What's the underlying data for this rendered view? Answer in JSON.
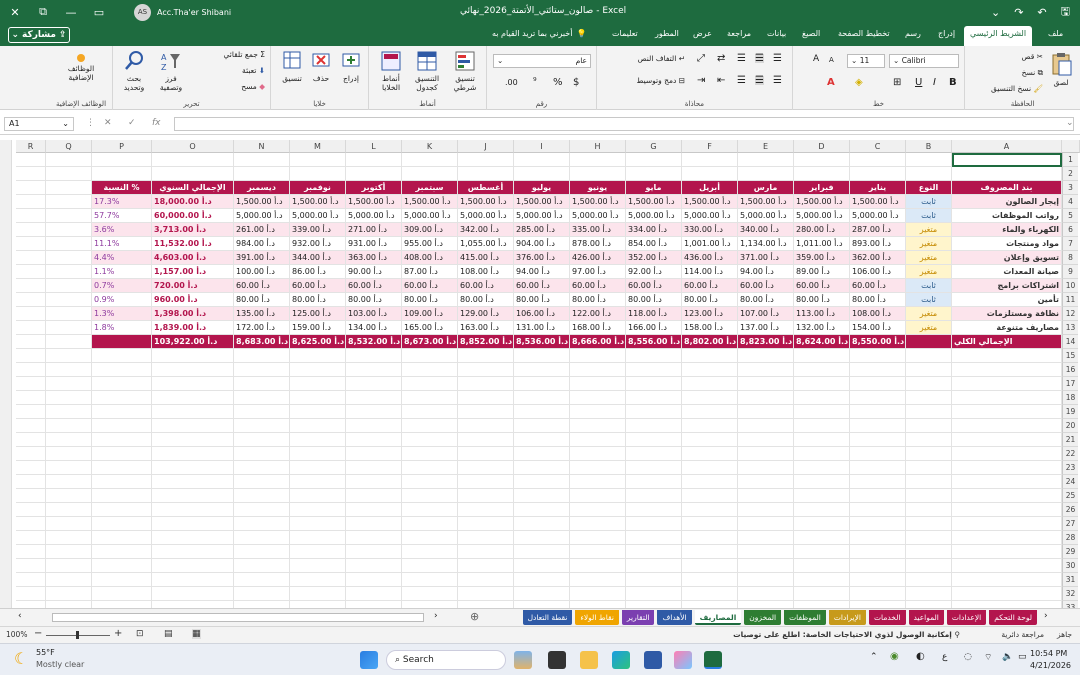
{
  "titlebar": {
    "app": "Excel",
    "filename": "صالون_ستائتي_الأتمتة_2026_نهائي",
    "separator": "-",
    "user_initials": "AS",
    "user_name": "Acc.Tha'er Shibani"
  },
  "tabs": [
    "ملف",
    "الشريط الرئيسي",
    "إدراج",
    "رسم",
    "تخطيط الصفحة",
    "الصيغ",
    "بيانات",
    "مراجعة",
    "عرض",
    "المطور",
    "تعليمات"
  ],
  "tell_me": "أخبرني بما تريد القيام به",
  "share": "مشاركة",
  "ribbon": {
    "clipboard": {
      "label": "الحافظة",
      "paste": "لصق",
      "cut": "قص",
      "copy": "نسخ",
      "format_painter": "نسخ التنسيق"
    },
    "font": {
      "label": "خط",
      "name": "Calibri",
      "size": "11",
      "bold": "B",
      "italic": "I",
      "underline": "U"
    },
    "alignment": {
      "label": "محاذاة",
      "wrap": "التفاف النص",
      "merge": "دمج وتوسيط"
    },
    "number": {
      "label": "رقم",
      "format": "عام",
      "currency": "$",
      "percent": "%"
    },
    "styles": {
      "label": "أنماط",
      "conditional": "تنسيق شرطي",
      "table": "التنسيق كجدول",
      "cell_styles": "أنماط الخلايا"
    },
    "cells": {
      "label": "خلايا",
      "insert": "إدراج",
      "delete": "حذف",
      "format": "تنسيق"
    },
    "editing": {
      "label": "تحرير",
      "autosum": "جمع تلقائي",
      "fill": "تعبئة",
      "clear": "مسح",
      "sort": "فرز وتصفية",
      "find": "بحث وتحديد"
    },
    "addins": {
      "label": "الوظائف الإضافية",
      "btn": "الوظائف الإضافية"
    }
  },
  "formula": {
    "namebox": "A1",
    "fx": "fx",
    "value": ""
  },
  "columns": [
    "A",
    "B",
    "C",
    "D",
    "E",
    "F",
    "G",
    "H",
    "I",
    "J",
    "K",
    "L",
    "M",
    "N",
    "O",
    "P",
    "Q",
    "R"
  ],
  "rows": [
    "1",
    "2",
    "3",
    "4",
    "5",
    "6",
    "7",
    "8",
    "9",
    "10",
    "11",
    "12",
    "13",
    "14",
    "15",
    "16",
    "17",
    "18",
    "19",
    "20",
    "21",
    "22",
    "23",
    "24",
    "25",
    "26",
    "27",
    "28",
    "29",
    "30",
    "31",
    "32",
    "33"
  ],
  "table": {
    "headers": [
      "بند المصروف",
      "النوع",
      "يناير",
      "فبراير",
      "مارس",
      "أبريل",
      "مايو",
      "يونيو",
      "يوليو",
      "أغسطس",
      "سبتمبر",
      "أكتوبر",
      "نوفمبر",
      "ديسمبر",
      "الإجمالي السنوي",
      "النسبة %"
    ],
    "rows": [
      [
        "إيجار الصالون",
        "ثابت",
        "1,500.00 د.أ",
        "1,500.00 د.أ",
        "1,500.00 د.أ",
        "1,500.00 د.أ",
        "1,500.00 د.أ",
        "1,500.00 د.أ",
        "1,500.00 د.أ",
        "1,500.00 د.أ",
        "1,500.00 د.أ",
        "1,500.00 د.أ",
        "1,500.00 د.أ",
        "1,500.00 د.أ",
        "18,000.00 د.أ",
        "17.3%"
      ],
      [
        "رواتب الموظفات",
        "ثابت",
        "5,000.00 د.أ",
        "5,000.00 د.أ",
        "5,000.00 د.أ",
        "5,000.00 د.أ",
        "5,000.00 د.أ",
        "5,000.00 د.أ",
        "5,000.00 د.أ",
        "5,000.00 د.أ",
        "5,000.00 د.أ",
        "5,000.00 د.أ",
        "5,000.00 د.أ",
        "5,000.00 د.أ",
        "60,000.00 د.أ",
        "57.7%"
      ],
      [
        "الكهرباء والماء",
        "متغير",
        "287.00 د.أ",
        "280.00 د.أ",
        "340.00 د.أ",
        "330.00 د.أ",
        "334.00 د.أ",
        "335.00 د.أ",
        "285.00 د.أ",
        "342.00 د.أ",
        "309.00 د.أ",
        "271.00 د.أ",
        "339.00 د.أ",
        "261.00 د.أ",
        "3,713.00 د.أ",
        "3.6%"
      ],
      [
        "مواد ومنتجات",
        "متغير",
        "893.00 د.أ",
        "1,011.00 د.أ",
        "1,134.00 د.أ",
        "1,001.00 د.أ",
        "854.00 د.أ",
        "878.00 د.أ",
        "904.00 د.أ",
        "1,055.00 د.أ",
        "955.00 د.أ",
        "931.00 د.أ",
        "932.00 د.أ",
        "984.00 د.أ",
        "11,532.00 د.أ",
        "11.1%"
      ],
      [
        "تسويق وإعلان",
        "متغير",
        "362.00 د.أ",
        "359.00 د.أ",
        "371.00 د.أ",
        "436.00 د.أ",
        "352.00 د.أ",
        "426.00 د.أ",
        "376.00 د.أ",
        "415.00 د.أ",
        "408.00 د.أ",
        "363.00 د.أ",
        "344.00 د.أ",
        "391.00 د.أ",
        "4,603.00 د.أ",
        "4.4%"
      ],
      [
        "صيانة المعدات",
        "متغير",
        "106.00 د.أ",
        "89.00 د.أ",
        "94.00 د.أ",
        "114.00 د.أ",
        "92.00 د.أ",
        "97.00 د.أ",
        "94.00 د.أ",
        "108.00 د.أ",
        "87.00 د.أ",
        "90.00 د.أ",
        "86.00 د.أ",
        "100.00 د.أ",
        "1,157.00 د.أ",
        "1.1%"
      ],
      [
        "اشتراكات برامج",
        "ثابت",
        "60.00 د.أ",
        "60.00 د.أ",
        "60.00 د.أ",
        "60.00 د.أ",
        "60.00 د.أ",
        "60.00 د.أ",
        "60.00 د.أ",
        "60.00 د.أ",
        "60.00 د.أ",
        "60.00 د.أ",
        "60.00 د.أ",
        "60.00 د.أ",
        "720.00 د.أ",
        "0.7%"
      ],
      [
        "تأمين",
        "ثابت",
        "80.00 د.أ",
        "80.00 د.أ",
        "80.00 د.أ",
        "80.00 د.أ",
        "80.00 د.أ",
        "80.00 د.أ",
        "80.00 د.أ",
        "80.00 د.أ",
        "80.00 د.أ",
        "80.00 د.أ",
        "80.00 د.أ",
        "80.00 د.أ",
        "960.00 د.أ",
        "0.9%"
      ],
      [
        "نظافة ومستلزمات",
        "متغير",
        "108.00 د.أ",
        "113.00 د.أ",
        "107.00 د.أ",
        "123.00 د.أ",
        "118.00 د.أ",
        "122.00 د.أ",
        "106.00 د.أ",
        "129.00 د.أ",
        "109.00 د.أ",
        "103.00 د.أ",
        "125.00 د.أ",
        "135.00 د.أ",
        "1,398.00 د.أ",
        "1.3%"
      ],
      [
        "مصاريف متنوعة",
        "متغير",
        "154.00 د.أ",
        "132.00 د.أ",
        "137.00 د.أ",
        "158.00 د.أ",
        "166.00 د.أ",
        "168.00 د.أ",
        "131.00 د.أ",
        "163.00 د.أ",
        "165.00 د.أ",
        "134.00 د.أ",
        "159.00 د.أ",
        "172.00 د.أ",
        "1,839.00 د.أ",
        "1.8%"
      ]
    ],
    "total": [
      "الإجمالي الكلي",
      "",
      "8,550.00 د.أ",
      "8,624.00 د.أ",
      "8,823.00 د.أ",
      "8,802.00 د.أ",
      "8,556.00 د.أ",
      "8,666.00 د.أ",
      "8,536.00 د.أ",
      "8,852.00 د.أ",
      "8,673.00 د.أ",
      "8,532.00 د.أ",
      "8,625.00 د.أ",
      "8,683.00 د.أ",
      "103,922.00 د.أ",
      ""
    ]
  },
  "sheets": [
    {
      "name": "لوحة التحكم",
      "color": "#b3154d"
    },
    {
      "name": "الإعدادات",
      "color": "#b3154d"
    },
    {
      "name": "المواعيد",
      "color": "#b3154d"
    },
    {
      "name": "الخدمات",
      "color": "#b3154d"
    },
    {
      "name": "الإيرادات",
      "color": "#c79a1b"
    },
    {
      "name": "الموظفات",
      "color": "#2e7d32"
    },
    {
      "name": "المخزون",
      "color": "#2e7d32"
    },
    {
      "name": "المصاريف",
      "color": "#e8e8e8",
      "active": true
    },
    {
      "name": "الأهداف",
      "color": "#2f5aa6"
    },
    {
      "name": "التقارير",
      "color": "#7b3fb0"
    },
    {
      "name": "نقاط الولاء",
      "color": "#f0a500"
    },
    {
      "name": "نقطة التعادل",
      "color": "#2f5aa6"
    }
  ],
  "status": {
    "ready": "جاهز",
    "accessibility": "مراجعة دائرية",
    "notice": "إمكانية الوصول لذوي الاحتياجات الخاصة: اطلع على توصيات",
    "zoom": "100%"
  },
  "taskbar": {
    "temp": "55°F",
    "weather": "Mostly clear",
    "search": "Search",
    "lang": "ع",
    "time": "10:54 PM",
    "date": "4/21/2026"
  }
}
